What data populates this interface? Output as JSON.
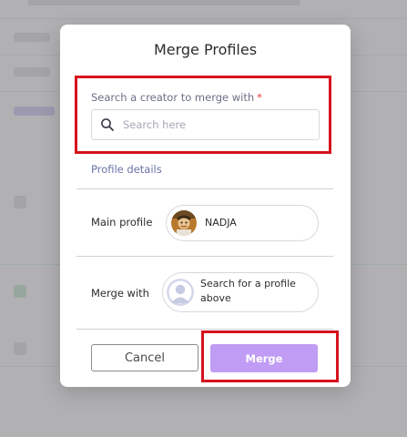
{
  "modal": {
    "title": "Merge Profiles",
    "search": {
      "label": "Search a creator to merge with",
      "required_marker": "*",
      "placeholder": "Search here",
      "value": ""
    },
    "profile_details_link": "Profile details",
    "main_profile": {
      "label": "Main profile",
      "name": "NADJA"
    },
    "merge_with": {
      "label": "Merge with",
      "text": "Search for a profile above"
    },
    "buttons": {
      "cancel": "Cancel",
      "merge": "Merge"
    }
  },
  "colors": {
    "merge_button": "#c19cf4",
    "highlight": "#d5121d",
    "required_star": "#e23d3d"
  },
  "icons": {
    "search": "search-icon",
    "main_avatar": "avatar",
    "placeholder_avatar": "user-placeholder-icon"
  }
}
